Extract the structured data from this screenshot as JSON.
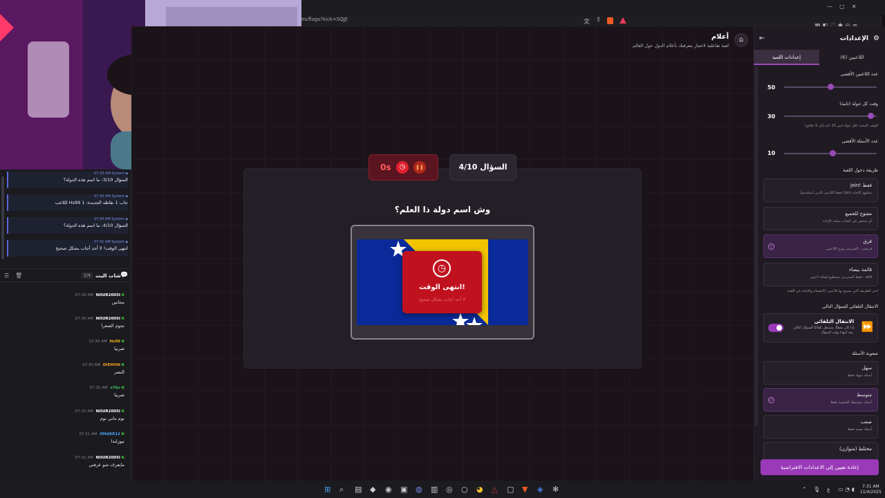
{
  "browser": {
    "url": "es/flags?kick=SQJJl",
    "toolbar_icons": [
      "translate-icon",
      "share-icon",
      "brave-shield-icon",
      "brave-rewards-icon"
    ],
    "window_controls": [
      "minimize-icon",
      "maximize-icon",
      "close-icon"
    ]
  },
  "header": {
    "title": "أعلام",
    "subtitle": "لعبة تفاعلية لاختبار معرفتك بأعلام الدول حول العالم",
    "home_icon": "home-icon"
  },
  "game": {
    "timer": "0s",
    "question_counter": "السؤال 4/10",
    "question": "وش اسم دولة ذا العلم؟",
    "time_up_title": "انتهى الوقت!",
    "time_up_subtitle": "لا أحد أجاب بشكل صحيح"
  },
  "chat": {
    "system_messages": [
      {
        "time": "07:30 AM",
        "user": "System",
        "text": "السؤال 3/10: ما اسم هذه الدولة؟"
      },
      {
        "time": "07:30 AM",
        "user": "System",
        "text": "اللاعب Hs99 جاب 1 نقاطه الجديدة: 1"
      },
      {
        "time": "07:30 AM",
        "user": "System",
        "text": "السؤال 4/10: ما اسم هذه الدولة؟"
      },
      {
        "time": "07:31 AM",
        "user": "System",
        "text": "انتهى الوقت! لا أحد أجاب بشكل صحيح"
      }
    ],
    "live_chat_title": "شات البث",
    "live_chat_count": "1/4",
    "messages": [
      {
        "time": "07:30 AM",
        "user": "NOUR2005I",
        "color": "#ffffff",
        "text": "مجانين"
      },
      {
        "time": "07:30 AM",
        "user": "NOUR2005I",
        "color": "#ffffff",
        "text": "نجوم الصغرا"
      },
      {
        "time": "07:30 AM",
        "user": "Hs99",
        "color": "#f0b020",
        "text": "صربيا"
      },
      {
        "time": "07:30 AM",
        "user": "DIEMON",
        "color": "#f0a020",
        "text": "النصر"
      },
      {
        "time": "07:31 AM",
        "user": "s7ljv",
        "color": "#40c060",
        "text": "صربيا"
      },
      {
        "time": "07:31 AM",
        "user": "NOUR2005I",
        "color": "#ffffff",
        "text": "نوم ماني نوم"
      },
      {
        "time": "07:31 AM",
        "user": "0MARR12",
        "color": "#4aa0f0",
        "text": "نيوزلندا"
      },
      {
        "time": "07:31 AM",
        "user": "NOUR2005I",
        "color": "#ffffff",
        "text": "مايعرف شو عرفني"
      }
    ]
  },
  "settings": {
    "title": "الإعدادات",
    "tabs": {
      "players": "اللاعبين (6)",
      "game": "إعدادات اللعبة"
    },
    "max_players_label": "عدد اللاعبين الأقصى",
    "max_players_value": "50",
    "max_players_level": 0.5,
    "round_time_label": "وقت كل جولة (ثانية)",
    "round_time_value": "30",
    "round_time_level": 0.93,
    "round_time_hint": "الوقت المحدد لكل جولة (من 15 ثانية إلى 5 دقائق)",
    "max_questions_label": "عدد الأسئلة الأقصى",
    "max_questions_value": "10",
    "max_questions_level": 0.52,
    "join_method_label": "طريقة دخول اللعبة",
    "join_options": [
      {
        "title": "join! فقط",
        "desc": "فقط اللاعبين الذين استخدموا !join يمكنهم الإجابة",
        "selected": false
      },
      {
        "title": "مفتوح للجميع",
        "desc": "أي شخص في الشات يمكنه الإجابة",
        "selected": false
      },
      {
        "title": "فرق",
        "desc": "فريقين - الستريمر يوزع اللاعبين",
        "selected": true
      },
      {
        "title": "قائمة بيضاء",
        "desc": "فقط الستريمر يستطيع إضافة لاعبين - add",
        "selected": false
      }
    ],
    "join_hint": "اختر الطريقة التي يسمح بها للاعبين بالانضمام والإجابة في اللعبة",
    "auto_advance_label": "الانتقال التلقائي للسؤال التالي",
    "auto_advance_title": "الانتقال التلقائي",
    "auto_advance_desc": "إذا كان مفعلًا، سينتقل تلقائيًا للسؤال التالي بعد انتهاء وقت السؤال.",
    "difficulty_label": "صعوبة الأسئلة",
    "difficulty_options": [
      {
        "title": "سهل",
        "desc": "أسئلة سهلة فقط",
        "selected": false
      },
      {
        "title": "متوسط",
        "desc": "أسئلة متوسطة الصعوبة فقط",
        "selected": true
      },
      {
        "title": "صعب",
        "desc": "أسئلة صعبة فقط",
        "selected": false
      },
      {
        "title": "مختلط (متوازن)",
        "desc": "",
        "selected": false
      }
    ],
    "reset_button": "إعادة تعيين إلى الاعدادات الافتراضية"
  },
  "taskbar": {
    "time": "7:31 AM",
    "date": "11/4/2025",
    "lang": "ع"
  },
  "colors": {
    "accent": "#9a3ab8",
    "danger": "#c0121e",
    "flag_blue": "#0a2a9a",
    "flag_yellow": "#f2c400"
  }
}
